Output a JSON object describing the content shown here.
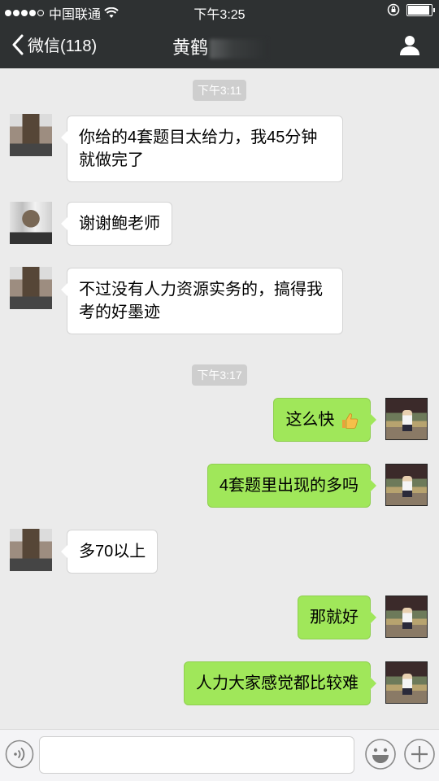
{
  "status_bar": {
    "carrier": "中国联通",
    "time": "下午3:25"
  },
  "nav": {
    "back_label": "微信(118)",
    "title": "黄鹤"
  },
  "messages": [
    {
      "type": "timestamp",
      "text": "下午3:11"
    },
    {
      "type": "message",
      "side": "left",
      "text": "你给的4套题目太给力，我45分钟就做完了"
    },
    {
      "type": "message",
      "side": "left",
      "text": "谢谢鲍老师"
    },
    {
      "type": "message",
      "side": "left",
      "text": "不过没有人力资源实务的，搞得我考的好墨迹"
    },
    {
      "type": "timestamp",
      "text": "下午3:17"
    },
    {
      "type": "message",
      "side": "right",
      "text": "这么快"
    },
    {
      "type": "message",
      "side": "right",
      "text": "4套题里出现的多吗"
    },
    {
      "type": "message",
      "side": "left",
      "text": "多70以上"
    },
    {
      "type": "message",
      "side": "right",
      "text": "那就好"
    },
    {
      "type": "message",
      "side": "right",
      "text": "人力大家感觉都比较难"
    }
  ],
  "input_bar": {
    "icons": [
      "voice-icon",
      "emoji-icon",
      "plus-icon"
    ]
  },
  "colors": {
    "header_bg": "#2e3132",
    "chat_bg": "#ebebeb",
    "bubble_self": "#a0e75a",
    "bubble_other": "#ffffff"
  }
}
